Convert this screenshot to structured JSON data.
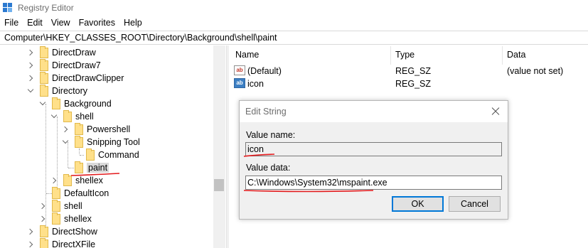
{
  "window": {
    "title": "Registry Editor",
    "icon": "registry-editor-icon"
  },
  "menu": {
    "items": [
      {
        "label": "File"
      },
      {
        "label": "Edit"
      },
      {
        "label": "View"
      },
      {
        "label": "Favorites"
      },
      {
        "label": "Help"
      }
    ]
  },
  "address": {
    "path": "Computer\\HKEY_CLASSES_ROOT\\Directory\\Background\\shell\\paint"
  },
  "tree": {
    "items": [
      {
        "label": "DirectDraw",
        "state": "collapsed",
        "icon": "folder-icon"
      },
      {
        "label": "DirectDraw7",
        "state": "collapsed",
        "icon": "folder-icon"
      },
      {
        "label": "DirectDrawClipper",
        "state": "collapsed",
        "icon": "folder-icon"
      },
      {
        "label": "Directory",
        "state": "expanded",
        "icon": "folder-icon"
      },
      {
        "label": "Background",
        "state": "expanded",
        "icon": "folder-icon"
      },
      {
        "label": "shell",
        "state": "expanded",
        "icon": "folder-icon"
      },
      {
        "label": "Powershell",
        "state": "collapsed",
        "icon": "folder-icon"
      },
      {
        "label": "Snipping Tool",
        "state": "expanded",
        "icon": "folder-icon"
      },
      {
        "label": "Command",
        "state": "leaf",
        "icon": "folder-icon"
      },
      {
        "label": "paint",
        "state": "selected",
        "icon": "folder-icon"
      },
      {
        "label": "shellex",
        "state": "collapsed",
        "icon": "folder-icon"
      },
      {
        "label": "DefaultIcon",
        "state": "leaf",
        "icon": "folder-icon"
      },
      {
        "label": "shell",
        "state": "collapsed",
        "icon": "folder-icon"
      },
      {
        "label": "shellex",
        "state": "collapsed",
        "icon": "folder-icon"
      },
      {
        "label": "DirectShow",
        "state": "collapsed",
        "icon": "folder-icon"
      },
      {
        "label": "DirectXFile",
        "state": "collapsed",
        "icon": "folder-icon"
      }
    ]
  },
  "list": {
    "columns": [
      "Name",
      "Type",
      "Data"
    ],
    "rows": [
      {
        "name": "(Default)",
        "type": "REG_SZ",
        "data": "(value not set)",
        "icon": "string-value-icon"
      },
      {
        "name": "icon",
        "type": "REG_SZ",
        "data": "",
        "icon": "string-value-icon"
      }
    ]
  },
  "dialog": {
    "title": "Edit String",
    "value_name_label": "Value name:",
    "value_name": "icon",
    "value_data_label": "Value data:",
    "value_data": "C:\\Windows\\System32\\mspaint.exe",
    "ok_label": "OK",
    "cancel_label": "Cancel"
  },
  "colors": {
    "annotation": "#e31a1c",
    "folder": "#ffe08a",
    "selection": "#d9d9d9",
    "default_button_border": "#0078d7"
  }
}
